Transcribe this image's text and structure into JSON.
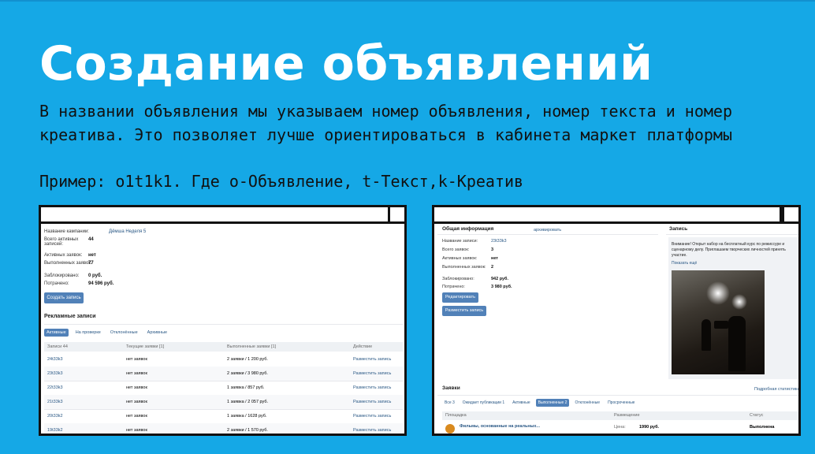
{
  "slide": {
    "title": "Создание объявлений",
    "description": "В названии объявления мы указываем номер объявления, номер текста и номер креатива. Это позволяет лучше ориентироваться в кабинета маркет платформы",
    "example": "Пример: o1t1k1. Где o-Объявление, t-Текст,k-Креатив"
  },
  "left": {
    "info": [
      {
        "label": "Название кампании:",
        "value": "Дёмша Неделя 5"
      },
      {
        "label": "Всего активных записей:",
        "value": "44"
      },
      {
        "label": "Активных заявок:",
        "value": "нет"
      },
      {
        "label": "Выполненных заявок:",
        "value": "77"
      },
      {
        "label": "Заблокировано:",
        "value": "0 руб."
      },
      {
        "label": "Потрачено:",
        "value": "94 596 руб."
      }
    ],
    "create_btn": "Создать запись",
    "section_title": "Рекламные записи",
    "tabs": [
      "Активные",
      "На проверке",
      "Отклонённые",
      "Архивные"
    ],
    "columns": [
      "Записи 44",
      "Текущие заявки [1]",
      "Выполненные заявки [1]",
      "Действие"
    ],
    "rows": [
      [
        "24t33k3",
        "нет заявок",
        "2 заявки / 1 200 руб.",
        "Разместить запись"
      ],
      [
        "23t33k3",
        "нет заявок",
        "2 заявки / 3 980 руб.",
        "Разместить запись"
      ],
      [
        "22t33k3",
        "нет заявок",
        "1 заявка / 857 руб.",
        "Разместить запись"
      ],
      [
        "21t33k3",
        "нет заявок",
        "1 заявка / 2 057 руб.",
        "Разместить запись"
      ],
      [
        "20t33k2",
        "нет заявок",
        "1 заявка / 1628 руб.",
        "Разместить запись"
      ],
      [
        "19t33k2",
        "нет заявок",
        "2 заявки / 1 570 руб.",
        "Разместить запись"
      ]
    ]
  },
  "right": {
    "info_title": "Общая информация",
    "archive_link": "архивировать",
    "record_title": "Запись",
    "info": [
      {
        "label": "Название записи:",
        "value": "23t33k3"
      },
      {
        "label": "Всего заявок:",
        "value": "3"
      },
      {
        "label": "Активных заявок:",
        "value": "нет"
      },
      {
        "label": "Выполненных заявок:",
        "value": "2"
      },
      {
        "label": "Заблокировано:",
        "value": "942 руб."
      },
      {
        "label": "Потрачено:",
        "value": "3 980 руб."
      }
    ],
    "edit_btn": "Редактировать",
    "place_btn": "Разместить запись",
    "ad_text": "Внимание! Открыт набор на бесплатный курс по режиссуре и сценарному делу. Приглашаем творческих личностей принять участие.",
    "show_more": "Показать ещё",
    "requests_title": "Заявки",
    "stats_link": "Подробная статистика",
    "tabs": [
      "Все 3",
      "Ожидает публикации 1",
      "Активные",
      "Выполненные 2",
      "Отклонённые",
      "Просроченные"
    ],
    "columns": [
      "Площадка",
      "Размещение",
      "Статус"
    ],
    "row": {
      "name": "Фильмы, основанные на реальных...",
      "price_label": "Цена:",
      "price": "1990 руб.",
      "status": "Выполнена"
    }
  },
  "colors": {
    "background": "#15a8e6",
    "vk_blue": "#5181b8",
    "frame": "#111111"
  }
}
